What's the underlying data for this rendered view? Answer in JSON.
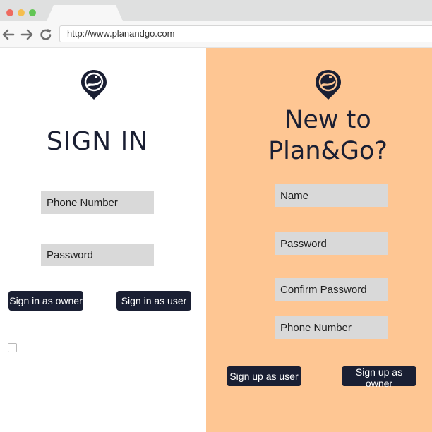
{
  "browser": {
    "url": "http://www.planandgo.com",
    "colors": {
      "close": "#ee6a5f",
      "minimize": "#f5be4f",
      "maximize": "#62c554"
    }
  },
  "icons": {
    "back": "arrow-left-icon",
    "forward": "arrow-right-icon",
    "reload": "reload-icon",
    "logo": "location-pin-icon"
  },
  "colors": {
    "accent_dark": "#1a1f33",
    "signup_panel": "#fec693",
    "field_bg": "#d9d9d9"
  },
  "sign_in": {
    "title": "SIGN IN",
    "phone_placeholder": "Phone Number",
    "password_placeholder": "Password",
    "owner_button": "Sign in as owner",
    "user_button": "Sign in as user"
  },
  "sign_up": {
    "title_line1": "New to",
    "title_line2": "Plan&Go?",
    "name_placeholder": "Name",
    "password_placeholder": "Password",
    "confirm_password_placeholder": "Confirm Password",
    "phone_placeholder": "Phone Number",
    "user_button": "Sign up as user",
    "owner_button": "Sign up as owner"
  }
}
